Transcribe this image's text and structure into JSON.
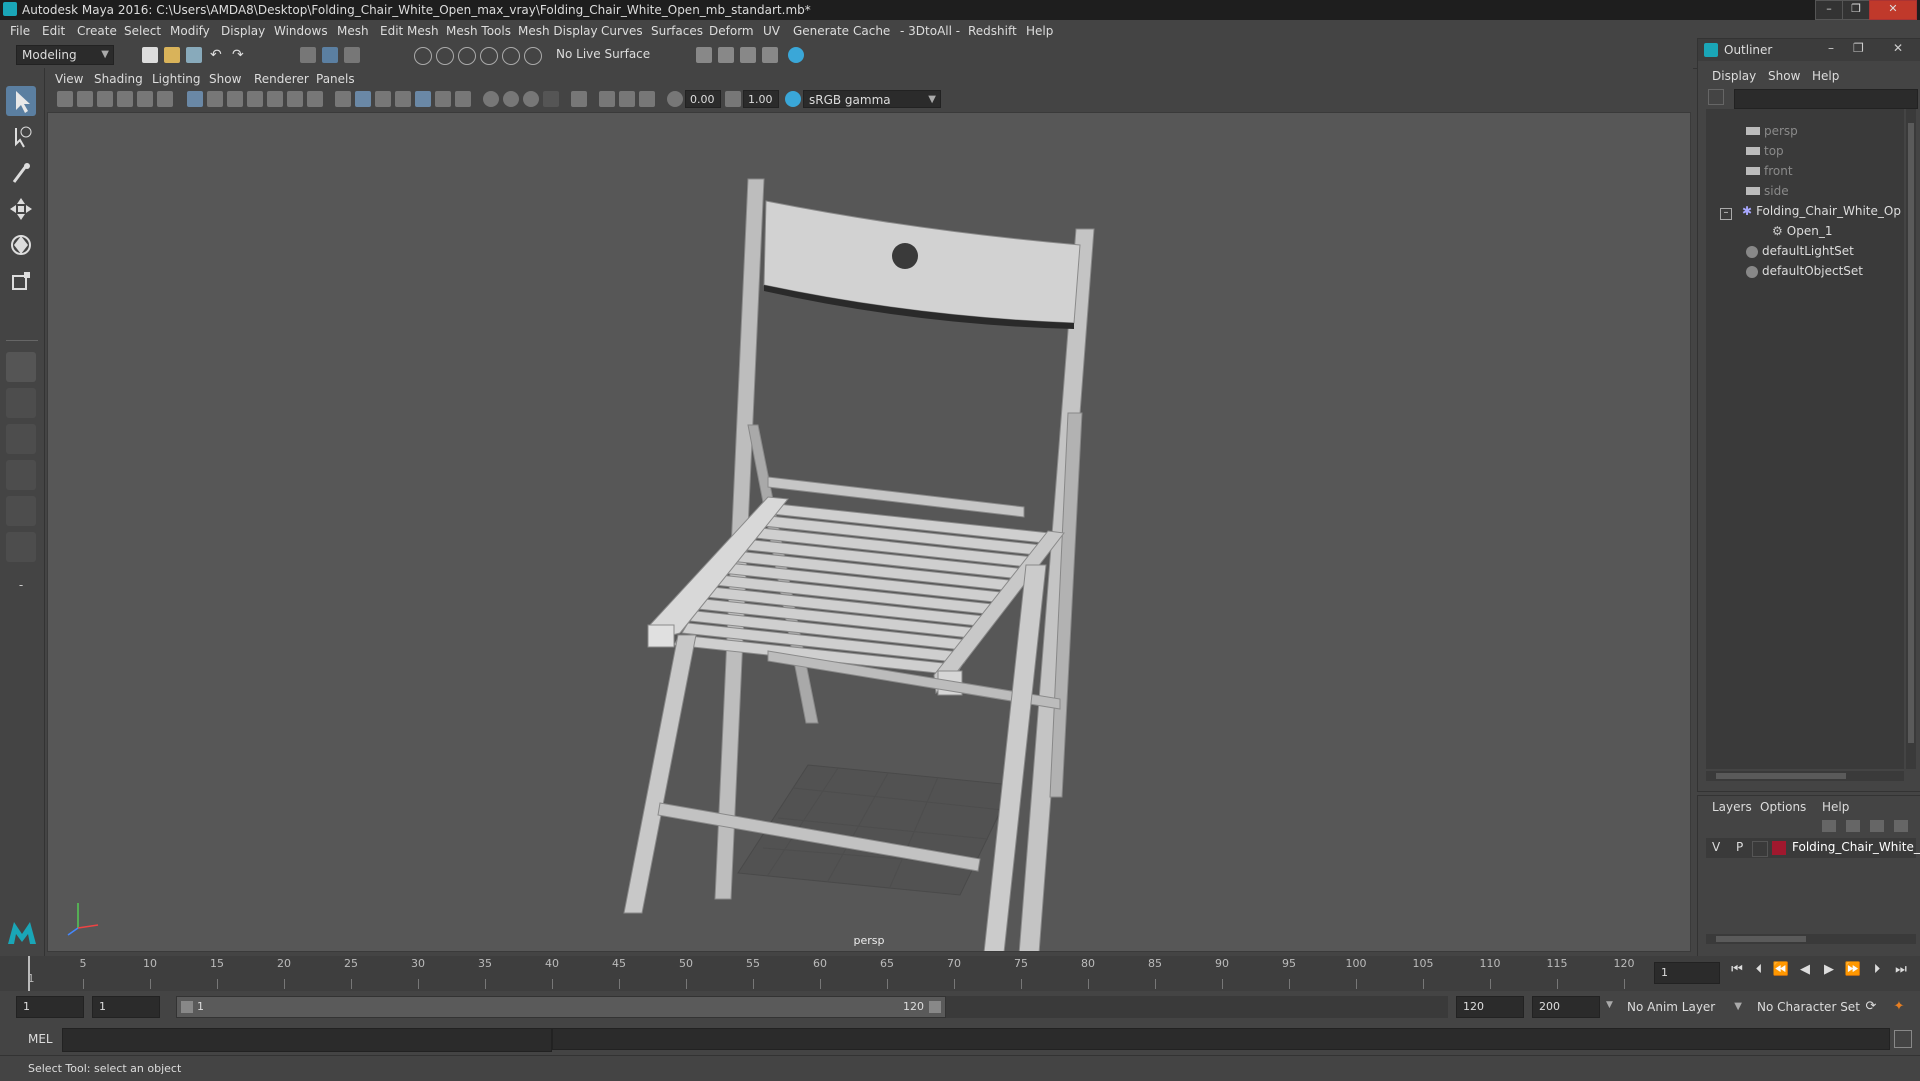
{
  "window": {
    "title": "Autodesk Maya 2016: C:\\Users\\AMDA8\\Desktop\\Folding_Chair_White_Open_max_vray\\Folding_Chair_White_Open_mb_standart.mb*"
  },
  "menubar": [
    "File",
    "Edit",
    "Create",
    "Select",
    "Modify",
    "Display",
    "Windows",
    "Mesh",
    "Edit Mesh",
    "Mesh Tools",
    "Mesh Display",
    "Curves",
    "Surfaces",
    "Deform",
    "UV",
    "Generate",
    "Cache",
    "- 3DtoAll -",
    "Redshift",
    "Help"
  ],
  "shelf": {
    "mode": "Modeling",
    "live_surface": "No Live Surface"
  },
  "viewport": {
    "menu": [
      "View",
      "Shading",
      "Lighting",
      "Show",
      "Renderer",
      "Panels"
    ],
    "exposure": "0.00",
    "gamma": "1.00",
    "color_space": "sRGB gamma",
    "camera_label": "persp"
  },
  "outliner": {
    "title": "Outliner",
    "menu": [
      "Display",
      "Show",
      "Help"
    ],
    "items": [
      {
        "label": "persp",
        "dim": true
      },
      {
        "label": "top",
        "dim": true
      },
      {
        "label": "front",
        "dim": true
      },
      {
        "label": "side",
        "dim": true
      },
      {
        "label": "Folding_Chair_White_Op"
      },
      {
        "label": "Open_1"
      },
      {
        "label": "defaultLightSet"
      },
      {
        "label": "defaultObjectSet"
      }
    ]
  },
  "layers": {
    "menu": [
      "Layers",
      "Options",
      "Help"
    ],
    "row": {
      "v": "V",
      "p": "P",
      "name": "Folding_Chair_White_(",
      "color": "#a0182e"
    }
  },
  "timeline": {
    "ticks": [
      "5",
      "10",
      "15",
      "20",
      "25",
      "30",
      "35",
      "40",
      "45",
      "50",
      "55",
      "60",
      "65",
      "70",
      "75",
      "80",
      "85",
      "90",
      "95",
      "100",
      "105",
      "110",
      "115",
      "120"
    ],
    "current_frame_marker": "1",
    "current_frame": "1"
  },
  "range": {
    "start": "1",
    "anim_start": "1",
    "slider_start": "1",
    "slider_end": "120",
    "anim_end": "120",
    "end": "200",
    "anim_layer": "No Anim Layer",
    "character_set": "No Character Set"
  },
  "cmdline": {
    "label": "MEL"
  },
  "helpline": {
    "text": "Select Tool: select an object"
  },
  "colors": {
    "accent": "#5b7fa1",
    "viewport_bg": "#575757",
    "layer_color": "#a0182e"
  }
}
